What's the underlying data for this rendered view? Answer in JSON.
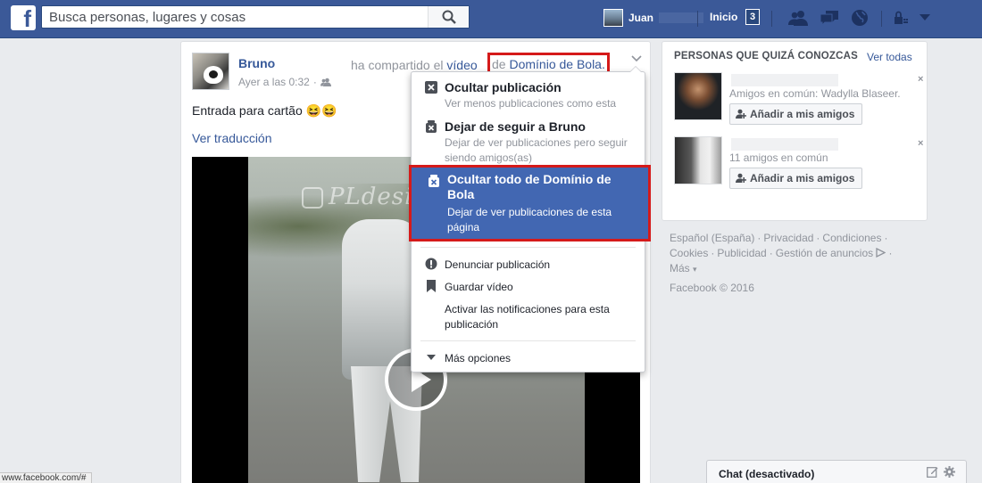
{
  "topbar": {
    "logo": "f",
    "search_placeholder": "Busca personas, lugares y cosas",
    "user_name": "Juan",
    "home_label": "Inicio",
    "home_count": "3"
  },
  "post": {
    "author": "Bruno",
    "shared_prefix": "ha compartido el",
    "video_word": "vídeo",
    "de": "de",
    "page_name": "Domínio de Bola.",
    "timestamp": "Ayer a las 0:32",
    "meta_sep": "·",
    "text": "Entrada para cartão 😆😆",
    "translate": "Ver traducción",
    "video_watermark": "PLdesignz"
  },
  "menu": {
    "items": [
      {
        "title": "Ocultar publicación",
        "sub": "Ver menos publicaciones como esta"
      },
      {
        "title": "Dejar de seguir a Bruno",
        "sub": "Dejar de ver publicaciones pero seguir siendo amigos(as)"
      },
      {
        "title": "Ocultar todo de Domínio de Bola",
        "sub": "Dejar de ver publicaciones de esta página"
      },
      {
        "label": "Denunciar publicación"
      },
      {
        "label": "Guardar vídeo"
      },
      {
        "label": "Activar las notificaciones para esta publicación"
      },
      {
        "label": "Más opciones"
      }
    ]
  },
  "pymk": {
    "title": "PERSONAS QUE QUIZÁ CONOZCAS",
    "see_all": "Ver todas",
    "people": [
      {
        "mutual": "Amigos en común: Wadylla Blaseer.",
        "add": "Añadir a mis amigos"
      },
      {
        "mutual": "11 amigos en común",
        "add": "Añadir a mis amigos"
      }
    ]
  },
  "footer": {
    "links": [
      "Español (España)",
      "Privacidad",
      "Condiciones",
      "Cookies",
      "Publicidad",
      "Gestión de anuncios",
      "Más"
    ],
    "copyright": "Facebook © 2016"
  },
  "chat": {
    "label": "Chat (desactivado)"
  },
  "status_url": "www.facebook.com/#",
  "colors": {
    "brand": "#3b5998",
    "link": "#365899",
    "highlight": "#4267b2",
    "annotation_red": "#d51a1a"
  }
}
